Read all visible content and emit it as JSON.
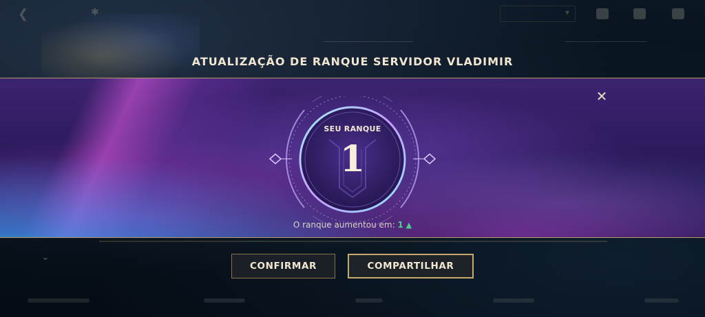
{
  "modal": {
    "title": "ATUALIZAÇÃO DE RANQUE SERVIDOR VLADIMIR",
    "close_glyph": "✕",
    "rank_label": "SEU RANQUE",
    "rank_value": "1",
    "rank_change_text": "O ranque aumentou em:",
    "rank_change_value": "1",
    "rank_change_icon": "arrow-up-icon",
    "confirm_label": "CONFIRMAR",
    "share_label": "COMPARTILHAR"
  },
  "colors": {
    "gold_text": "#f0e6d2",
    "gold_border": "#c8aa6e",
    "banner_purple": "#2c1a5c",
    "increase_green": "#4fd08a"
  }
}
